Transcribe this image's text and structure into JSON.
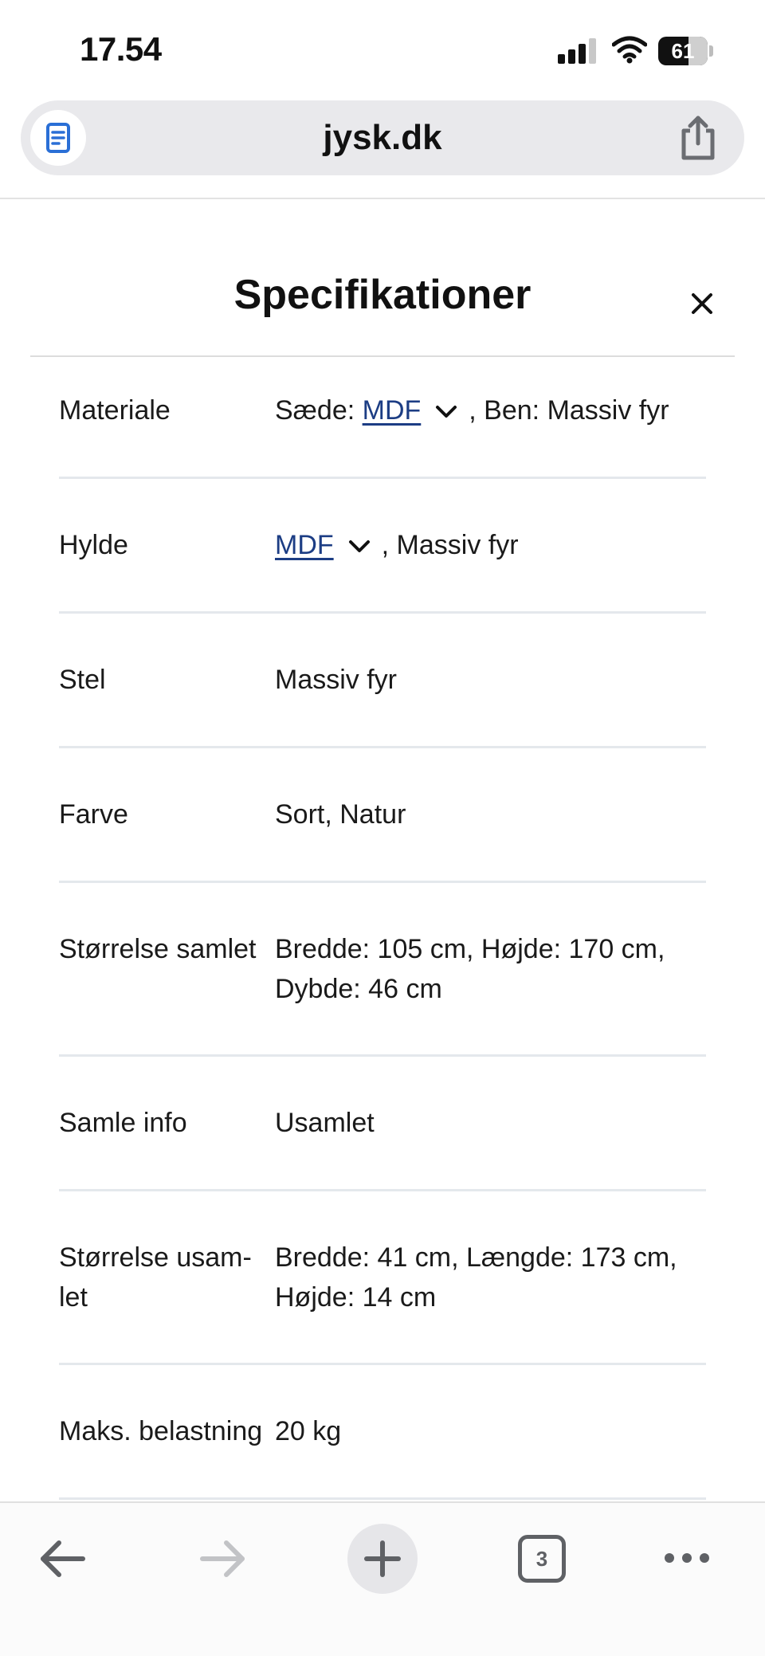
{
  "status_bar": {
    "time": "17.54",
    "battery": "61",
    "battery_percent": 61,
    "signal_icon": "cellular-signal-icon",
    "wifi_icon": "wifi-icon"
  },
  "browser": {
    "url": "jysk.dk",
    "reader_icon": "reader-mode-icon",
    "share_icon": "share-icon",
    "open_tabs": "3"
  },
  "modal": {
    "title": "Specifikationer",
    "close_icon": "close-icon"
  },
  "specs": [
    {
      "label": "Materiale",
      "prefix": "Sæde: ",
      "link": "MDF",
      "suffix": ", Ben: Massiv fyr"
    },
    {
      "label": "Hylde",
      "link": "MDF",
      "suffix": ", Massiv fyr"
    },
    {
      "label": "Stel",
      "value_line1": "Massiv fyr"
    },
    {
      "label": "Farve",
      "value_line1": "Sort, Natur"
    },
    {
      "label": "Størrelse samlet",
      "value_line1": "Bredde: 105 cm, Højde: 170 cm,",
      "value_line2": "Dybde: 46 cm"
    },
    {
      "label": "Samle info",
      "value_line1": "Usamlet"
    },
    {
      "label_line1": "Størrelse usam-",
      "label_line2": "let",
      "value_line1": "Bredde: 41 cm, Længde: 173 cm,",
      "value_line2": "Højde: 14 cm"
    },
    {
      "label": "Maks. belastning",
      "value_line1": "20 kg"
    }
  ],
  "colors": {
    "link": "#1c3d84",
    "reader_icon": "#2a6fd6",
    "divider": "#e4e8ec"
  }
}
